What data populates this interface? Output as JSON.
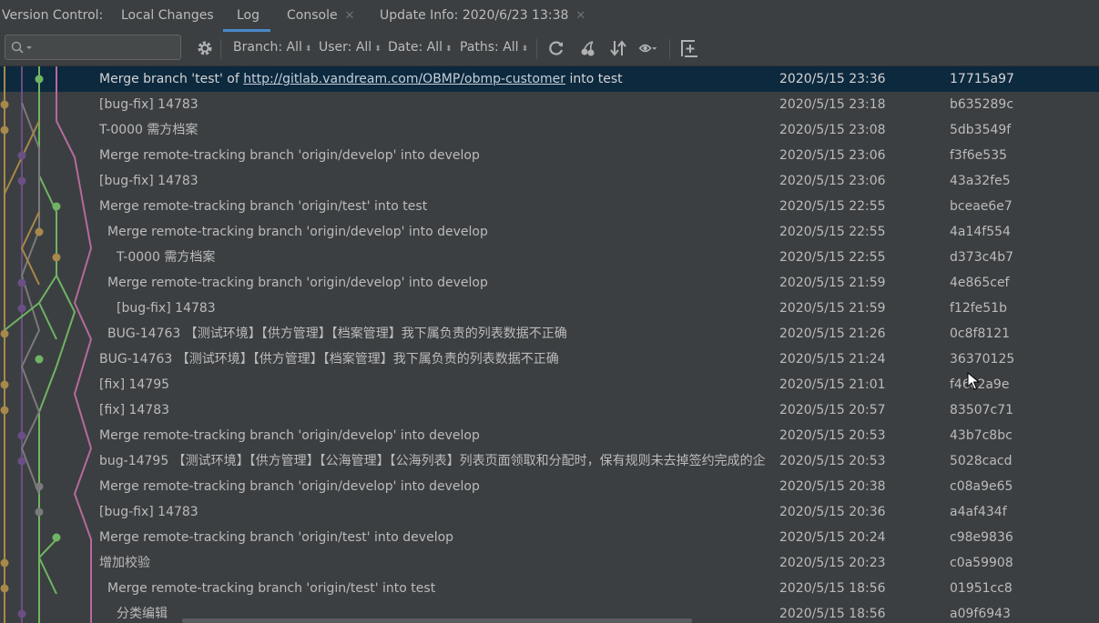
{
  "tabs": {
    "label": "Version Control:",
    "items": [
      {
        "label": "Local Changes"
      },
      {
        "label": "Log"
      },
      {
        "label": "Console"
      },
      {
        "label": "Update Info: 2020/6/23 13:38"
      }
    ]
  },
  "toolbar": {
    "search_placeholder": "",
    "filters": [
      "Branch: All",
      "User: All",
      "Date: All",
      "Paths: All"
    ]
  },
  "commits": [
    {
      "pre": "Merge branch 'test' of ",
      "link": "http://gitlab.vandream.com/OBMP/obmp-customer",
      "post": " into test",
      "date": "2020/5/15 23:36",
      "hash": "17715a97"
    },
    {
      "pre": "[bug-fix] 14783",
      "date": "2020/5/15 23:18",
      "hash": "b635289c"
    },
    {
      "pre": "T-0000 需方档案",
      "date": "2020/5/15 23:08",
      "hash": "5db3549f"
    },
    {
      "pre": "Merge remote-tracking branch 'origin/develop' into develop",
      "date": "2020/5/15 23:06",
      "hash": "f3f6e535"
    },
    {
      "pre": "[bug-fix] 14783",
      "date": "2020/5/15 23:06",
      "hash": "43a32fe5"
    },
    {
      "pre": "Merge remote-tracking branch 'origin/test' into test",
      "date": "2020/5/15 22:55",
      "hash": "bceae6e7"
    },
    {
      "pre": "Merge remote-tracking branch 'origin/develop' into develop",
      "date": "2020/5/15 22:55",
      "hash": "4a14f554"
    },
    {
      "pre": "T-0000 需方档案",
      "date": "2020/5/15 22:55",
      "hash": "d373c4b7"
    },
    {
      "pre": "Merge remote-tracking branch 'origin/develop' into develop",
      "date": "2020/5/15 21:59",
      "hash": "4e865cef"
    },
    {
      "pre": "[bug-fix] 14783",
      "date": "2020/5/15 21:59",
      "hash": "f12fe51b"
    },
    {
      "pre": "BUG-14763 【测试环境】【供方管理】【档案管理】我下属负责的列表数据不正确",
      "date": "2020/5/15 21:26",
      "hash": "0c8f8121"
    },
    {
      "pre": "BUG-14763 【测试环境】【供方管理】【档案管理】我下属负责的列表数据不正确",
      "date": "2020/5/15 21:24",
      "hash": "36370125"
    },
    {
      "pre": "[fix] 14795",
      "date": "2020/5/15 21:01",
      "hash": "f46c2a9e"
    },
    {
      "pre": "[fix] 14783",
      "date": "2020/5/15 20:57",
      "hash": "83507c71"
    },
    {
      "pre": "Merge remote-tracking branch 'origin/develop' into develop",
      "date": "2020/5/15 20:53",
      "hash": "43b7c8bc"
    },
    {
      "pre": "bug-14795 【测试环境】【供方管理】【公海管理】【公海列表】列表页面领取和分配时，保有规则未去掉签约完成的企",
      "date": "2020/5/15 20:53",
      "hash": "5028cacd"
    },
    {
      "pre": "Merge remote-tracking branch 'origin/develop' into develop",
      "date": "2020/5/15 20:38",
      "hash": "c08a9e65"
    },
    {
      "pre": "[bug-fix] 14783",
      "date": "2020/5/15 20:36",
      "hash": "a4af434f"
    },
    {
      "pre": "Merge remote-tracking branch 'origin/test' into develop",
      "date": "2020/5/15 20:24",
      "hash": "c98e9836"
    },
    {
      "pre": "增加校验",
      "date": "2020/5/15 20:23",
      "hash": "c0a59908"
    },
    {
      "pre": "Merge remote-tracking branch 'origin/test' into test",
      "date": "2020/5/15 18:56",
      "hash": "01951cc8"
    },
    {
      "pre": "分类编辑",
      "date": "2020/5/15 18:56",
      "hash": "a09f6943"
    }
  ],
  "colors": {
    "background": "#3c3f41",
    "selected_row": "#0d293e",
    "accent": "#4a88c7",
    "branch_gold": "#a8894a",
    "branch_purple": "#6a4f86",
    "branch_green": "#6fb464",
    "branch_pink": "#b66a9b",
    "branch_gray": "#7a7a7a"
  }
}
